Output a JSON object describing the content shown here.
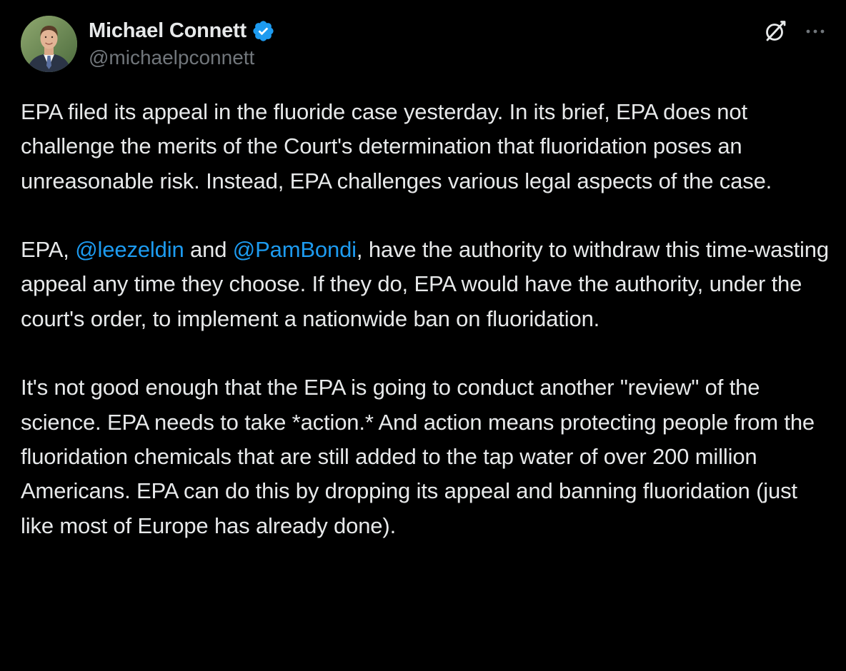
{
  "colors": {
    "background": "#000000",
    "text": "#e7e9ea",
    "secondary_text": "#71767b",
    "link": "#1d9bf0",
    "verified_badge": "#1d9bf0"
  },
  "author": {
    "display_name": "Michael Connett",
    "handle": "@michaelpconnett",
    "verified_icon": "verified-badge-icon",
    "avatar_icon": "avatar-photo"
  },
  "actions": {
    "grok_icon": "grok-slash-circle-icon",
    "more_icon": "more-horizontal-icon"
  },
  "tweet": {
    "p1": "EPA filed its appeal in the fluoride case yesterday. In its brief, EPA does not challenge the merits of the Court's determination that fluoridation poses an unreasonable risk. Instead, EPA challenges various legal aspects of the case.",
    "p2_a": "EPA, ",
    "p2_mention1": "@leezeldin",
    "p2_b": " and ",
    "p2_mention2": "@PamBondi",
    "p2_c": ", have the authority to withdraw this time-wasting appeal any time they choose. If they do, EPA would have the authority, under the court's order, to implement a nationwide ban on fluoridation.",
    "p3": "It's not good enough that the EPA is going to conduct another \"review\" of the science. EPA needs to take *action.* And action means protecting people from the fluoridation chemicals that are still added to the tap water of over 200 million Americans. EPA can do this by dropping its appeal and banning fluoridation (just like most of Europe has already done)."
  }
}
